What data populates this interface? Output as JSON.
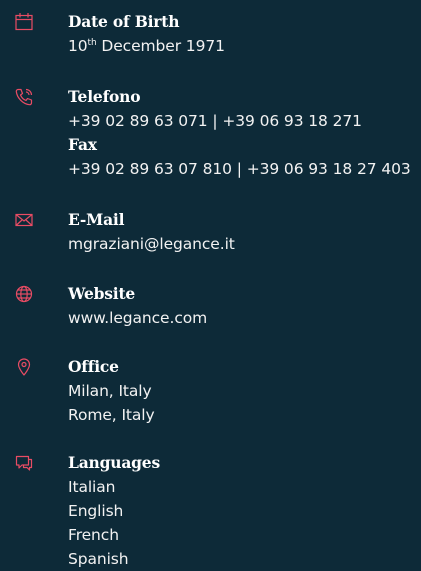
{
  "accent": "#e84c64",
  "background": "#0d2a38",
  "birth": {
    "label": "Date of Birth",
    "day": "10",
    "day_suffix": "th",
    "rest": " December 1971",
    "icon": "calendar-icon"
  },
  "phone": {
    "label": "Telefono",
    "value": "+39 02 89 63 071 | +39 06 93 18 271",
    "fax_label": "Fax",
    "fax_value": "+39 02 89 63 07 810 | +39 06 93 18 27 403",
    "icon": "phone-icon"
  },
  "email": {
    "label": "E-Mail",
    "value": "mgraziani@legance.it",
    "icon": "mail-icon"
  },
  "website": {
    "label": "Website",
    "value": "www.legance.com",
    "icon": "globe-icon"
  },
  "office": {
    "label": "Office",
    "values": [
      "Milan, Italy",
      "Rome, Italy"
    ],
    "icon": "location-pin-icon"
  },
  "languages": {
    "label": "Languages",
    "values": [
      "Italian",
      "English",
      "French",
      "Spanish"
    ],
    "icon": "chat-bubble-icon"
  }
}
